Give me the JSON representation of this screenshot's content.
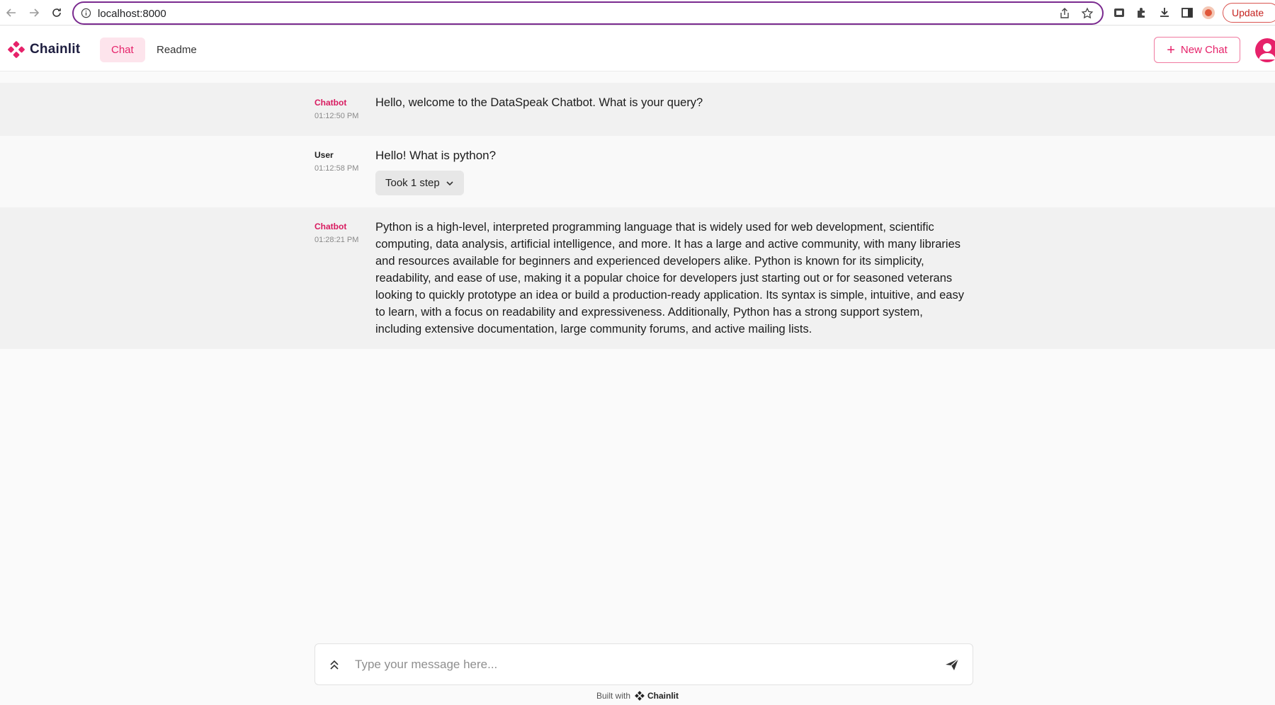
{
  "browser": {
    "url": "localhost:8000",
    "update_label": "Update"
  },
  "header": {
    "brand": "Chainlit",
    "tabs": [
      {
        "label": "Chat",
        "active": true
      },
      {
        "label": "Readme",
        "active": false
      }
    ],
    "new_chat_label": "New Chat"
  },
  "messages": [
    {
      "author": "Chatbot",
      "time": "01:12:50 PM",
      "text": "Hello, welcome to the DataSpeak Chatbot. What is your query?"
    },
    {
      "author": "User",
      "time": "01:12:58 PM",
      "text": "Hello! What is python?",
      "step_label": "Took 1 step"
    },
    {
      "author": "Chatbot",
      "time": "01:28:21 PM",
      "text": "Python is a high-level, interpreted programming language that is widely used for web development, scientific computing, data analysis, artificial intelligence, and more. It has a large and active community, with many libraries and resources available for beginners and experienced developers alike. Python is known for its simplicity, readability, and ease of use, making it a popular choice for developers just starting out or for seasoned veterans looking to quickly prototype an idea or build a production-ready application. Its syntax is simple, intuitive, and easy to learn, with a focus on readability and expressiveness. Additionally, Python has a strong support system, including extensive documentation, large community forums, and active mailing lists."
    }
  ],
  "composer": {
    "placeholder": "Type your message here..."
  },
  "footer": {
    "prefix": "Built with",
    "brand": "Chainlit"
  },
  "colors": {
    "accent": "#e6226a",
    "accent_light": "#fde4ec"
  }
}
